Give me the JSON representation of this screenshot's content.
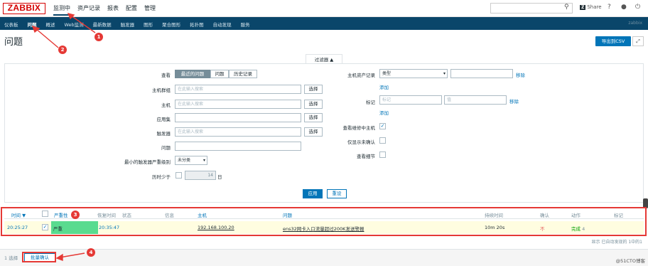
{
  "app": {
    "logo": "ZABBIX"
  },
  "main_menu": [
    "监测中",
    "资产记录",
    "报表",
    "配置",
    "管理"
  ],
  "header_right": {
    "share": "Share",
    "help": "?",
    "user": "⚲",
    "power": "⏻"
  },
  "sub_menu": [
    "仪表板",
    "问题",
    "概述",
    "Web监测",
    "最新数据",
    "触发器",
    "图形",
    "聚合图形",
    "拓扑图",
    "自动发现",
    "服务"
  ],
  "sub_menu_right": "zabbix",
  "page": {
    "title": "问题",
    "export_button": "导出到CSV"
  },
  "filter": {
    "tab_label": "过滤器 ▲",
    "view_label": "查看",
    "view_options": [
      "最近的问题",
      "问题",
      "历史记录"
    ],
    "host_group_label": "主机群组",
    "host_label": "主机",
    "app_label": "应用集",
    "trigger_label": "触发器",
    "problem_label": "问题",
    "min_severity_label": "最小的触发器严重级别",
    "min_severity_value": "未分类",
    "age_label": "历时少于",
    "age_value": "14",
    "age_unit": "日",
    "search_placeholder": "在此输入搜索",
    "select_button": "选择",
    "inventory_label": "主机资产记录",
    "inventory_field": "类型",
    "remove": "移除",
    "add": "添加",
    "tags_label": "标记",
    "tag_placeholder": "标记",
    "value_placeholder": "值",
    "show_maintenance_label": "查看维修中主机",
    "show_unack_label": "仅显示未确认",
    "show_details_label": "查看细节",
    "apply": "应用",
    "reset": "重设"
  },
  "table": {
    "headers": [
      "时间 ▼",
      "严重性",
      "恢复时间",
      "状态",
      "信息",
      "主机",
      "问题",
      "持续时间",
      "确认",
      "动作",
      "标记"
    ],
    "row": {
      "time": "20:25:27",
      "severity": "严重",
      "recovery_time": "20:35:47",
      "host": "192.168.100.20",
      "problem": "ens32网卡入口流量超过200K发送警报",
      "duration": "10m 20s",
      "ack": "不",
      "actions": "完成",
      "actions_count": "4"
    },
    "footer": "显示 已自动发现的 1中的1"
  },
  "bottom": {
    "selected": "1 选择",
    "bulk_ack": "批量确认",
    "watermark": "@51CTO博客"
  },
  "markers": [
    "1",
    "2",
    "3",
    "4"
  ],
  "colors": {
    "nav": "#0a466a",
    "accent": "#0275b8",
    "severity_high": "#59db8f",
    "annotation": "#e53935"
  }
}
